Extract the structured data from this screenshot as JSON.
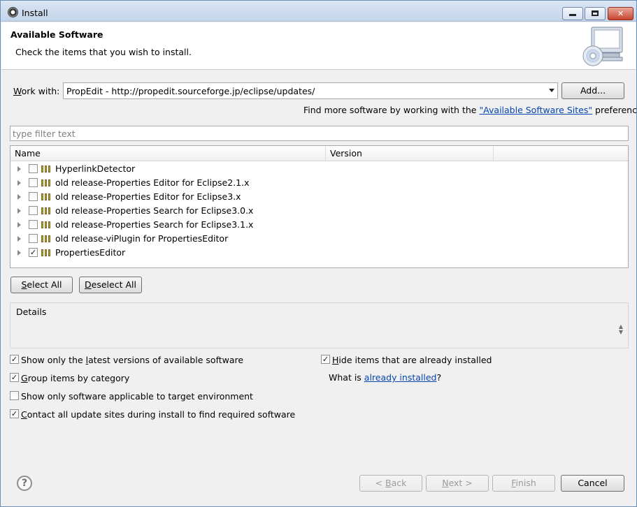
{
  "window": {
    "title": "Install",
    "controls": {
      "minimize": "minimize-icon",
      "maximize": "maximize-icon",
      "close": "close-icon"
    }
  },
  "header": {
    "title": "Available Software",
    "message": "Check the items that you wish to install."
  },
  "work_with": {
    "label_prefix": "",
    "label_mnemonic": "W",
    "label_rest": "ork with:",
    "value": "PropEdit - http://propedit.sourceforge.jp/eclipse/updates/",
    "add_button": "Add..."
  },
  "sites_hint": {
    "before": "Find more software by working with the ",
    "link": "\"Available Software Sites\"",
    "after": " preferences."
  },
  "filter": {
    "placeholder": "type filter text"
  },
  "table": {
    "columns": [
      "Name",
      "Version"
    ],
    "rows": [
      {
        "label": "HyperlinkDetector",
        "checked": false
      },
      {
        "label": "old release-Properties Editor for Eclipse2.1.x",
        "checked": false
      },
      {
        "label": "old release-Properties Editor for Eclipse3.x",
        "checked": false
      },
      {
        "label": "old release-Properties Search for Eclipse3.0.x",
        "checked": false
      },
      {
        "label": "old release-Properties Search for Eclipse3.1.x",
        "checked": false
      },
      {
        "label": "old release-viPlugin for PropertiesEditor",
        "checked": false
      },
      {
        "label": "PropertiesEditor",
        "checked": true
      }
    ]
  },
  "selection_buttons": {
    "select_all": {
      "mnemonic": "S",
      "rest": "elect All"
    },
    "deselect_all": {
      "mnemonic": "D",
      "rest": "eselect All"
    }
  },
  "details": {
    "label": "Details"
  },
  "options": {
    "latest": {
      "pre": "Show only the ",
      "mn": "l",
      "post": "atest versions of available software",
      "checked": true
    },
    "group": {
      "pre": "",
      "mn": "G",
      "post": "roup items by category",
      "checked": true
    },
    "applicable": {
      "pre": "Show only software applicable to target environment",
      "mn": "",
      "post": "",
      "checked": false
    },
    "contact": {
      "pre": "",
      "mn": "C",
      "post": "ontact all update sites during install to find required software",
      "checked": true
    },
    "hide": {
      "pre": "",
      "mn": "H",
      "post": "ide items that are already installed",
      "checked": true
    }
  },
  "installed_hint": {
    "before": "What is ",
    "link": "already installed",
    "after": "?"
  },
  "footer": {
    "help_icon": "help-icon",
    "back": {
      "pre": "< ",
      "mn": "B",
      "post": "ack"
    },
    "next": {
      "pre": "",
      "mn": "N",
      "post": "ext >"
    },
    "finish": {
      "pre": "",
      "mn": "F",
      "post": "inish"
    },
    "cancel": "Cancel"
  }
}
